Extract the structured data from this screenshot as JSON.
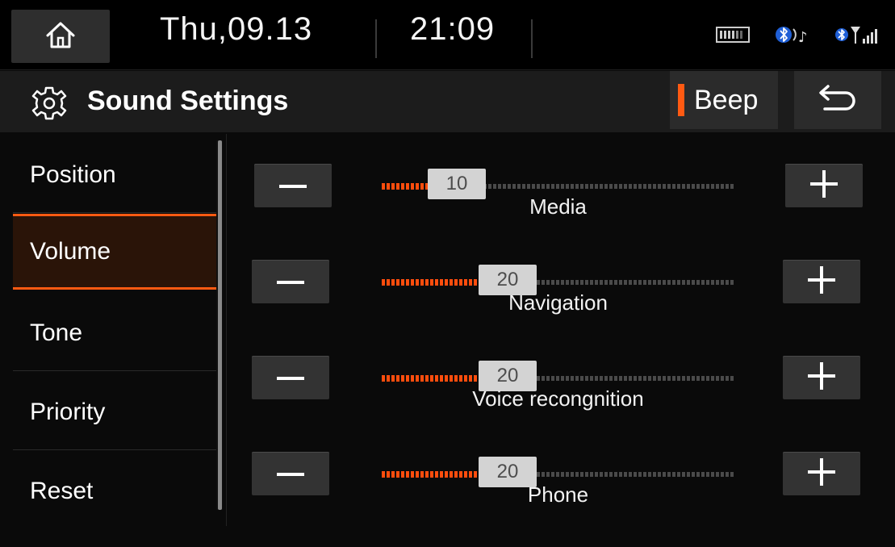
{
  "status_bar": {
    "date": "Thu,09.13",
    "time": "21:09",
    "icons": [
      "home-icon",
      "battery-icon",
      "bluetooth-audio-icon",
      "bluetooth-signal-icon"
    ]
  },
  "header": {
    "title": "Sound Settings",
    "beep_label": "Beep",
    "icons": [
      "gear-icon",
      "back-arrow-icon"
    ]
  },
  "sidebar": {
    "items": [
      {
        "label": "Position",
        "active": false
      },
      {
        "label": "Volume",
        "active": true
      },
      {
        "label": "Tone",
        "active": false
      },
      {
        "label": "Priority",
        "active": false
      },
      {
        "label": "Reset",
        "active": false
      }
    ]
  },
  "volume": {
    "max": 70,
    "rows": [
      {
        "label": "Media",
        "value": 10,
        "value_text": "10"
      },
      {
        "label": "Navigation",
        "value": 20,
        "value_text": "20"
      },
      {
        "label": "Voice recongnition",
        "value": 20,
        "value_text": "20"
      },
      {
        "label": "Phone",
        "value": 20,
        "value_text": "20"
      }
    ]
  },
  "colors": {
    "accent": "#ff5a12",
    "background": "#0a0a0a",
    "button": "#333333"
  }
}
